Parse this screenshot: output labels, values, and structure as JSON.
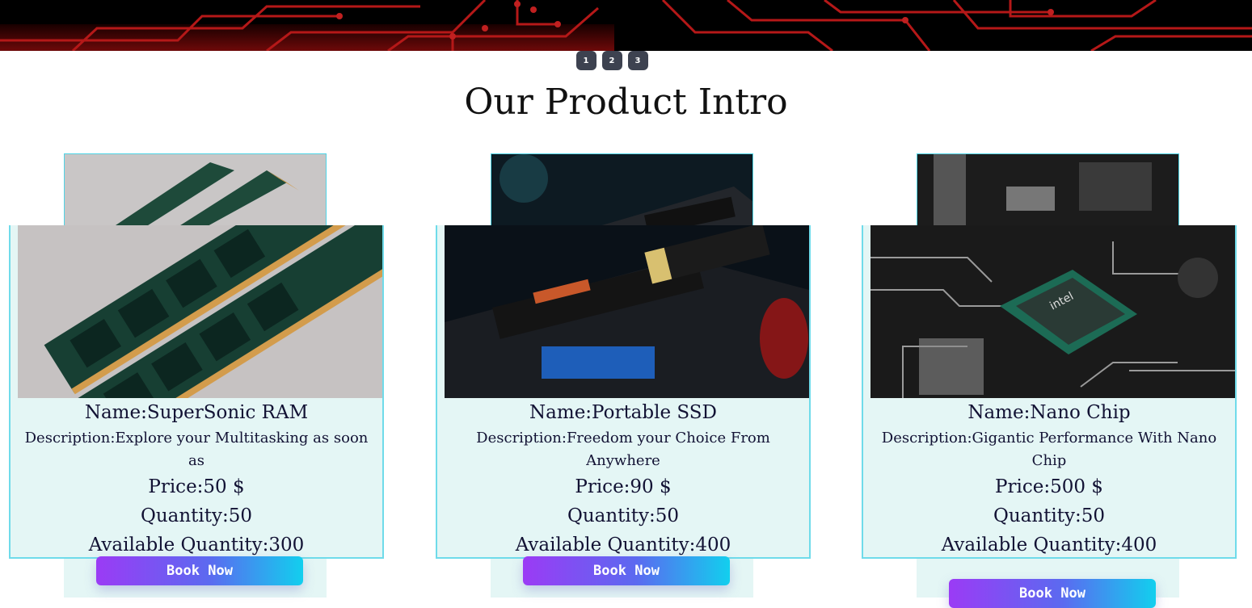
{
  "carousel": {
    "dots": [
      "1",
      "2",
      "3"
    ]
  },
  "section": {
    "title": "Our Product Intro"
  },
  "products": [
    {
      "name": "Name:SuperSonic RAM",
      "description": "Description:Explore your Multitasking as soon as",
      "price": "Price:50 $",
      "quantity": "Quantity:50",
      "available": "Available Quantity:300",
      "button": "Book Now"
    },
    {
      "name": "Name:Portable SSD",
      "description": "Description:Freedom your Choice From Anywhere",
      "price": "Price:90 $",
      "quantity": "Quantity:50",
      "available": "Available Quantity:400",
      "button": "Book Now"
    },
    {
      "name": "Name:Nano Chip",
      "description": "Description:Gigantic Performance With Nano Chip",
      "price": "Price:500 $",
      "quantity": "Quantity:50",
      "available": "Available Quantity:400",
      "button": "Book Now"
    }
  ],
  "colors": {
    "card_background": "#e4f6f5",
    "card_border": "#6fdbea",
    "button_gradient_start": "#9b3bf5",
    "button_gradient_end": "#12cfee",
    "dot_background": "#3d4250"
  }
}
